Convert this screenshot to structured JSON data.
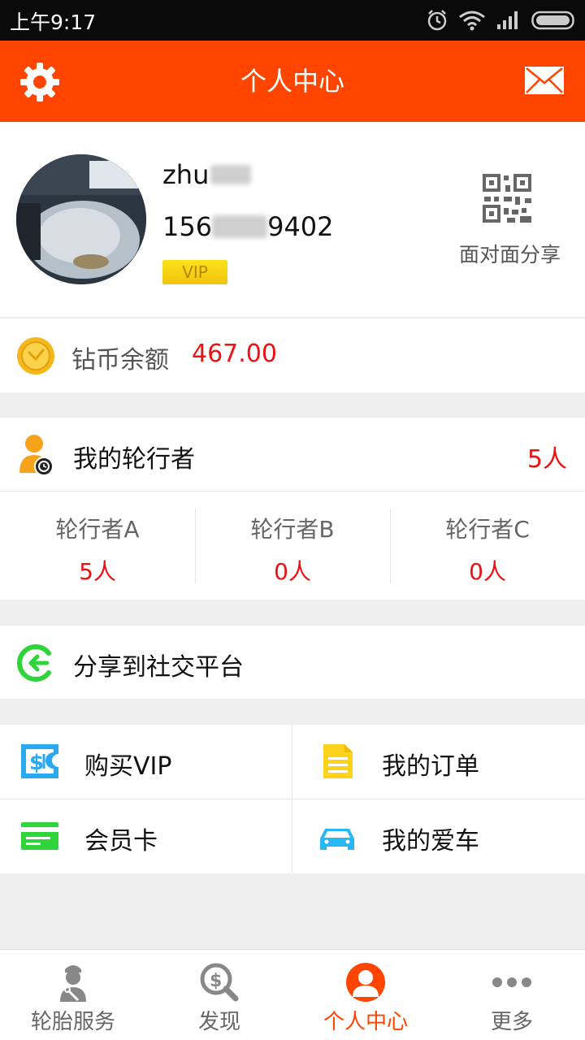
{
  "status_bar": {
    "time": "上午9:17"
  },
  "header": {
    "title": "个人中心",
    "settings_icon": "gear-icon",
    "message_icon": "mail-icon"
  },
  "profile": {
    "username": "zhu",
    "phone_prefix": "156",
    "phone_suffix": "9402",
    "badge": "VIP",
    "share_label": "面对面分享"
  },
  "balance": {
    "label": "钻币余额",
    "value": "467.00"
  },
  "riders": {
    "title": "我的轮行者",
    "total": "5人",
    "levels": [
      {
        "name": "轮行者A",
        "count": "5人"
      },
      {
        "name": "轮行者B",
        "count": "0人"
      },
      {
        "name": "轮行者C",
        "count": "0人"
      }
    ]
  },
  "share_platform": {
    "label": "分享到社交平台"
  },
  "actions": {
    "buy_vip": "购买VIP",
    "my_orders": "我的订单",
    "member_card": "会员卡",
    "my_car": "我的爱车"
  },
  "tabs": [
    {
      "label": "轮胎服务",
      "icon": "mechanic-icon"
    },
    {
      "label": "发现",
      "icon": "discover-icon"
    },
    {
      "label": "个人中心",
      "icon": "person-icon",
      "active": true
    },
    {
      "label": "更多",
      "icon": "more-icon"
    }
  ],
  "colors": {
    "brand": "#ff4500",
    "accent_red": "#ee1111",
    "vip_gold": "#f1c40f"
  }
}
